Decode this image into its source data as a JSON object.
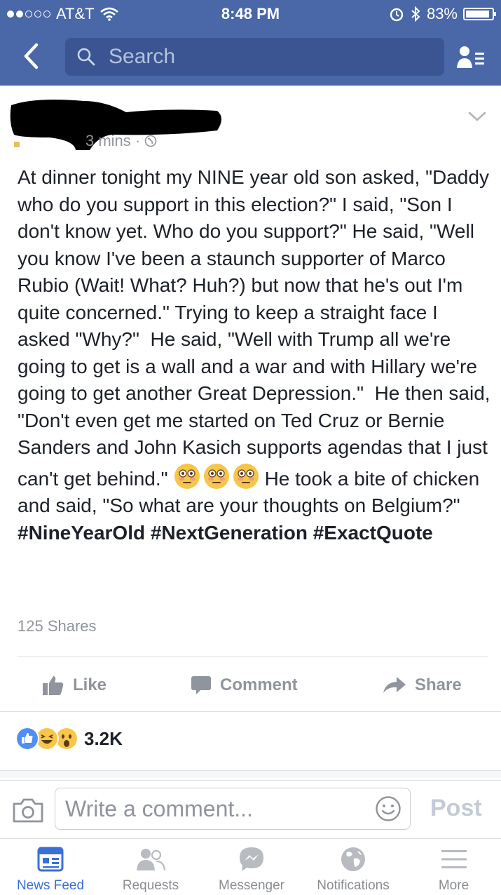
{
  "status_bar": {
    "carrier": "AT&T",
    "time": "8:48 PM",
    "battery": "83%",
    "battery_level": 0.83
  },
  "nav": {
    "search_placeholder": "Search"
  },
  "post": {
    "time_ago": "3 mins ·",
    "body_part1": "At dinner tonight my NINE year old son asked, \"Daddy who do you support in this election?\" I said, \"Son I don't know yet. Who do you support?\" He said, \"Well you know I've been a staunch supporter of Marco Rubio (Wait! What? Huh?) but now that he's out I'm quite concerned.\" Trying to keep a straight face I asked \"Why?\"  He said, \"Well with Trump all we're going to get is a wall and a war and with Hillary we're going to get another Great Depression.\"  He then said, \"Don't even get me started on Ted Cruz or Bernie Sanders and John Kasich supports agendas that I just can't get behind.\"",
    "body_part2": "He took a bite of chicken and said, \"So what are your thoughts on Belgium?\"",
    "hashtags": "#NineYearOld #NextGeneration #ExactQuote",
    "emoji_icons": [
      "flushed-face-icon",
      "flushed-face-icon",
      "flushed-face-icon"
    ],
    "shares": "125 Shares",
    "reaction_count": "3.2K",
    "reaction_icons": [
      "like-reaction-icon",
      "haha-reaction-icon",
      "wow-reaction-icon"
    ]
  },
  "actions": {
    "like": "Like",
    "comment": "Comment",
    "share": "Share"
  },
  "comment_bar": {
    "placeholder": "Write a comment...",
    "post_label": "Post"
  },
  "tabs": [
    {
      "label": "News Feed",
      "icon": "news-feed-icon",
      "active": true
    },
    {
      "label": "Requests",
      "icon": "friend-requests-icon",
      "active": false
    },
    {
      "label": "Messenger",
      "icon": "messenger-icon",
      "active": false
    },
    {
      "label": "Notifications",
      "icon": "globe-notifications-icon",
      "active": false
    },
    {
      "label": "More",
      "icon": "menu-icon",
      "active": false
    }
  ],
  "colors": {
    "brand": "#4a67a7",
    "active_tab": "#3b6fd8",
    "muted": "#90949c"
  }
}
